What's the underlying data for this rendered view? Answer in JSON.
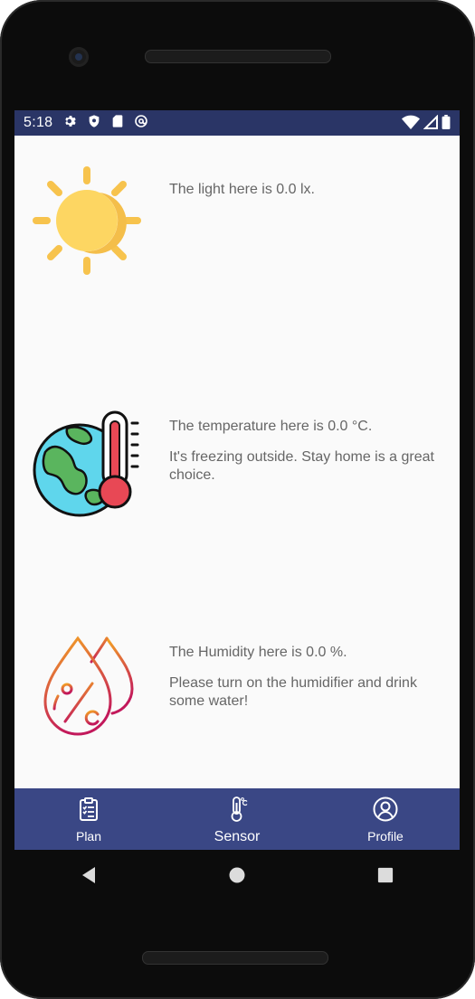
{
  "status_bar": {
    "time": "5:18",
    "icons": [
      "gear-icon",
      "shield-icon",
      "sd-card-icon",
      "at-sign-icon"
    ],
    "right_icons": [
      "wifi-icon",
      "signal-icon",
      "battery-icon"
    ]
  },
  "sections": [
    {
      "icon": "sun-icon",
      "lines": [
        "The light here is 0.0 lx."
      ]
    },
    {
      "icon": "earth-thermometer-icon",
      "lines": [
        "The temperature here is 0.0 °C.",
        "It's freezing outside. Stay home is a great choice."
      ]
    },
    {
      "icon": "humidity-drops-icon",
      "lines": [
        "The Humidity here is 0.0 %.",
        "Please turn on the humidifier and drink some water!"
      ]
    }
  ],
  "bottom_nav": {
    "items": [
      {
        "label": "Plan",
        "icon": "clipboard-icon"
      },
      {
        "label": "Sensor",
        "icon": "thermometer-icon",
        "active": true
      },
      {
        "label": "Profile",
        "icon": "user-circle-icon"
      }
    ]
  },
  "system_nav": [
    "back-icon",
    "home-icon",
    "recents-icon"
  ],
  "colors": {
    "status_bar": "#2a3566",
    "bottom_nav": "#3a4785",
    "body_text": "#666666",
    "sun": "#fdd662",
    "sun_rays": "#f7c34d",
    "drop_gradient_start": "#f5a623",
    "drop_gradient_end": "#c2185b"
  }
}
